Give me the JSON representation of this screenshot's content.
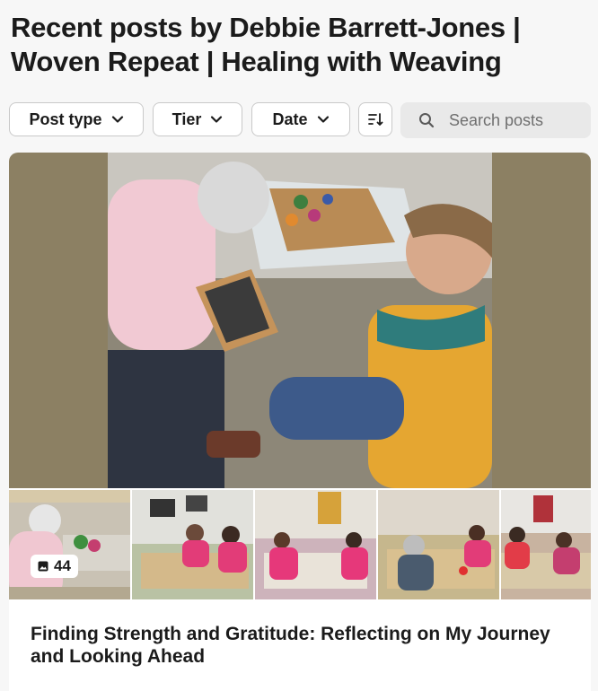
{
  "page": {
    "title": "Recent posts by Debbie Barrett-Jones | Woven Repeat | Healing with Weaving"
  },
  "filters": {
    "post_type": "Post type",
    "tier": "Tier",
    "date": "Date",
    "sort_icon": "sort-icon",
    "search_placeholder": "Search posts"
  },
  "post": {
    "image_count": "44",
    "title": "Finding Strength and Gratitude: Reflecting on My Journey and Looking Ahead"
  },
  "colors": {
    "background": "#f7f7f7",
    "pill_border": "#c9c9c9",
    "search_bg": "#e9e9e9",
    "text": "#1b1b1b"
  }
}
